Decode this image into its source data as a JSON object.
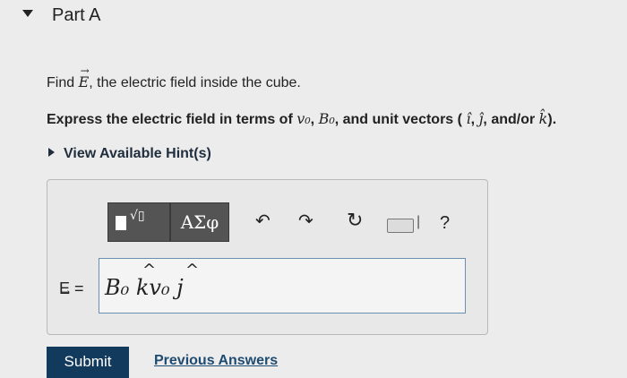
{
  "part": {
    "title": "Part A"
  },
  "question": {
    "find_prefix": "Find",
    "find_symbol": "E",
    "find_suffix": ", the electric field inside the cube.",
    "express_prefix": "Express the electric field in terms of",
    "var_v0": "v₀",
    "var_B0": "B₀",
    "express_middle": ", and unit vectors (",
    "unit_i": "î",
    "unit_j": "ĵ",
    "unit_k": "k̂",
    "express_andor": ", and/or",
    "express_suffix": ")."
  },
  "hints": {
    "label": "View Available Hint(s)"
  },
  "toolbar": {
    "templates_label": "√▯",
    "greek_label": "ΑΣφ",
    "undo_icon": "undo-icon",
    "redo_icon": "redo-icon",
    "reset_icon": "reset-icon",
    "keyboard_icon": "keyboard-icon",
    "separator": "|",
    "help_label": "?"
  },
  "answer": {
    "lhs": "E =",
    "value": "B₀ kv₀ j"
  },
  "actions": {
    "submit_label": "Submit",
    "previous_answers_label": "Previous Answers"
  }
}
